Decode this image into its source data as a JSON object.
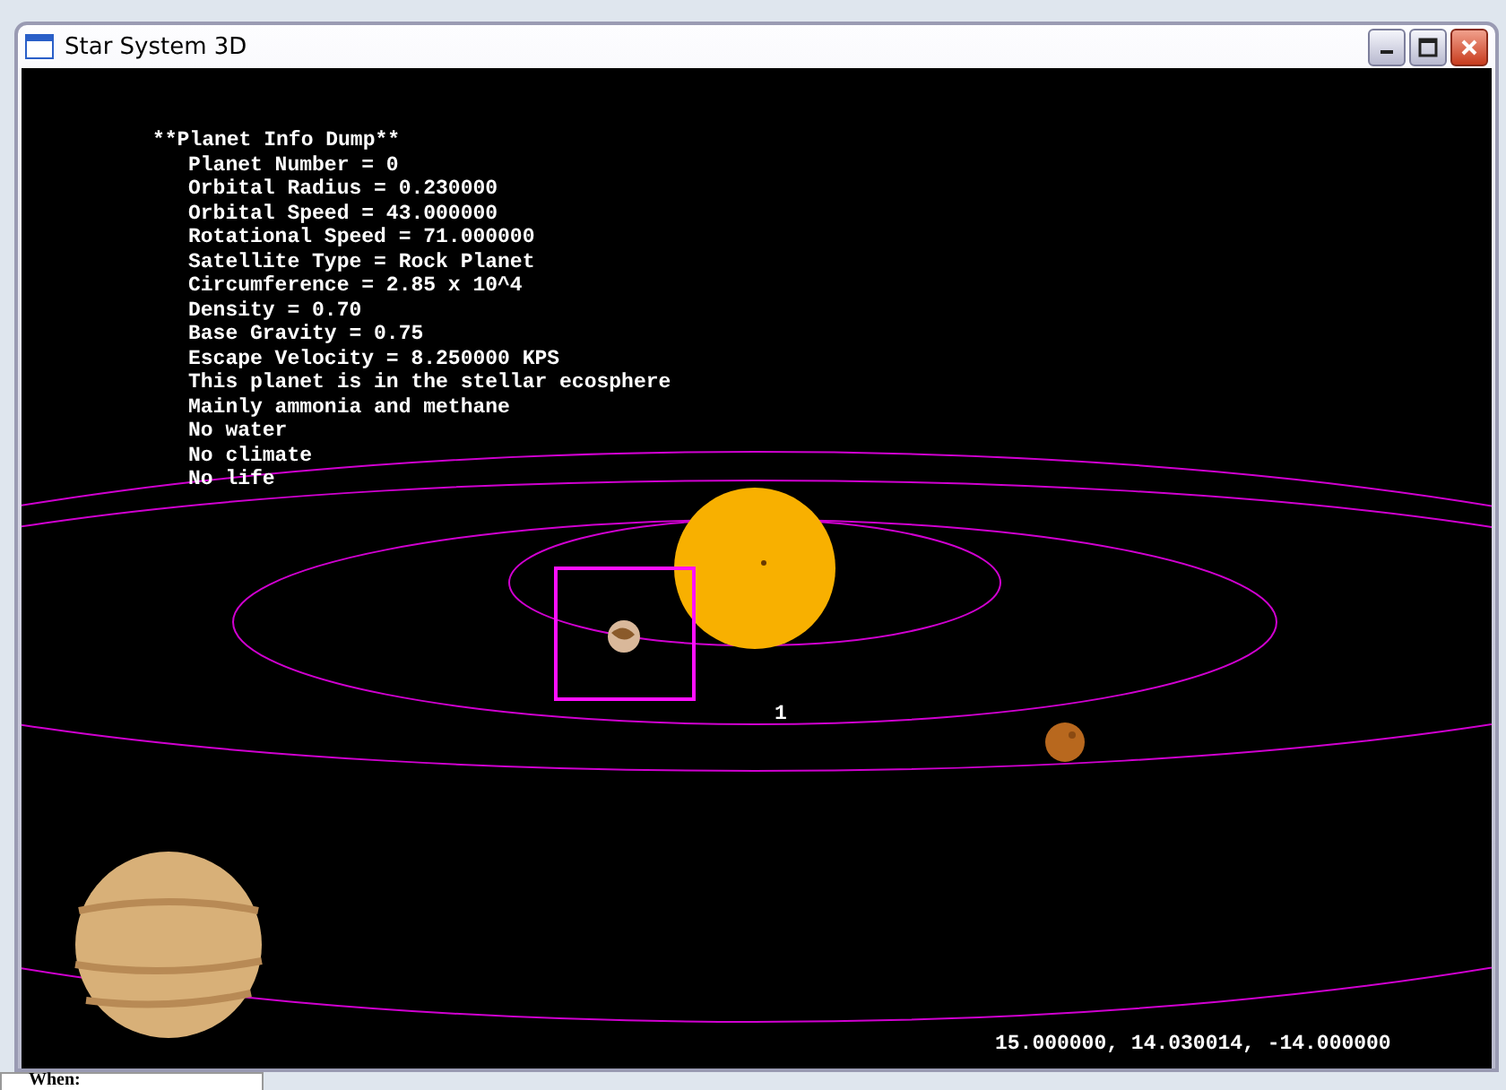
{
  "window": {
    "title": "Star System 3D"
  },
  "info_dump": {
    "title": "**Planet Info Dump**",
    "lines": [
      "Planet Number = 0",
      "Orbital Radius = 0.230000",
      "Orbital Speed = 43.000000",
      "Rotational Speed = 71.000000",
      "Satellite Type = Rock Planet",
      "Circumference = 2.85 x 10^4",
      "Density = 0.70",
      "Base Gravity = 0.75",
      "Escape Velocity = 8.250000 KPS",
      "This planet is in the stellar ecosphere",
      "Mainly ammonia and methane",
      "No water",
      "No climate",
      "No life"
    ]
  },
  "scene": {
    "planet_label": "1",
    "camera_position": "15.000000, 14.030014, -14.000000"
  },
  "background_window": {
    "label": "When:"
  }
}
